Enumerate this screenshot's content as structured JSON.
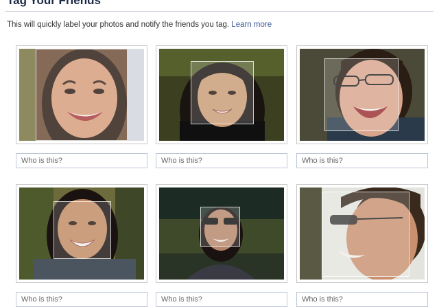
{
  "header": {
    "title": "Tag Your Friends",
    "description": "This will quickly label your photos and notify the friends you tag.",
    "learn_more": "Learn more"
  },
  "photos": [
    {
      "placeholder": "Who is this?"
    },
    {
      "placeholder": "Who is this?"
    },
    {
      "placeholder": "Who is this?"
    },
    {
      "placeholder": "Who is this?"
    },
    {
      "placeholder": "Who is this?"
    },
    {
      "placeholder": "Who is this?"
    }
  ],
  "colors": {
    "link": "#3b5998",
    "heading": "#1c2a47",
    "border": "#c8c8c8"
  }
}
